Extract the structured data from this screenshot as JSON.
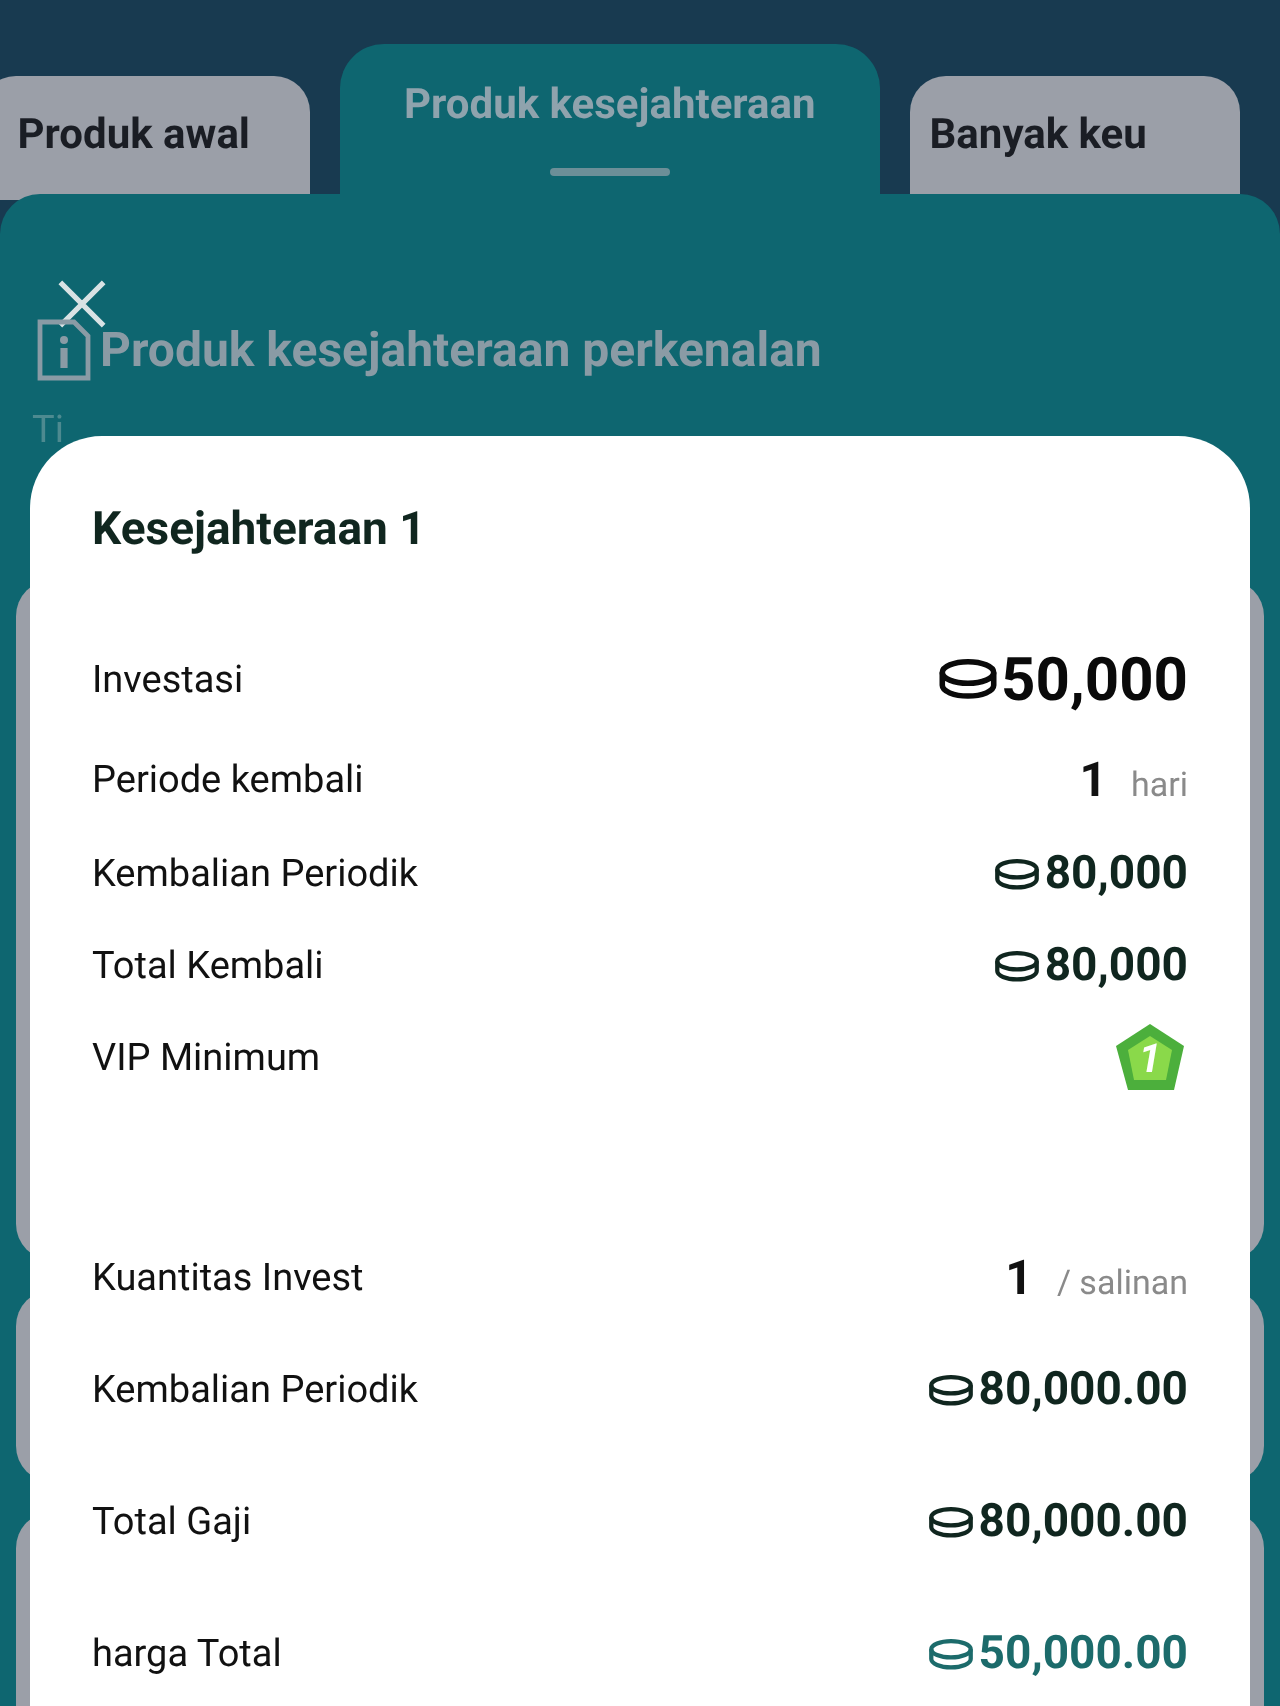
{
  "tabs": [
    {
      "label": "Produk awal",
      "selected": false
    },
    {
      "label": "Produk kesejahteraan",
      "selected": true
    },
    {
      "label": "Banyak keu",
      "selected": false
    }
  ],
  "panel": {
    "title": "Produk kesejahteraan perkenalan",
    "subtitle": "Ti"
  },
  "modal": {
    "title": "Kesejahteraan 1",
    "rows": [
      {
        "kind": "investment",
        "label": "Investasi",
        "value": "50,000"
      },
      {
        "kind": "unit",
        "label": "Periode kembali",
        "value": "1",
        "unit": "hari"
      },
      {
        "kind": "amount",
        "label": "Kembalian Periodik",
        "value": "80,000"
      },
      {
        "kind": "amount",
        "label": "Total Kembali",
        "value": "80,000"
      },
      {
        "kind": "vip",
        "label": "VIP Minimum",
        "value": "1"
      },
      {
        "kind": "unit",
        "label": "Kuantitas Invest",
        "value": "1",
        "unit": "/ salinan"
      },
      {
        "kind": "amount",
        "label": "Kembalian Periodik",
        "value": "80,000.00"
      },
      {
        "kind": "amount",
        "label": "Total Gaji",
        "value": "80,000.00"
      },
      {
        "kind": "price",
        "label": "harga Total",
        "value": "50,000.00"
      }
    ]
  }
}
